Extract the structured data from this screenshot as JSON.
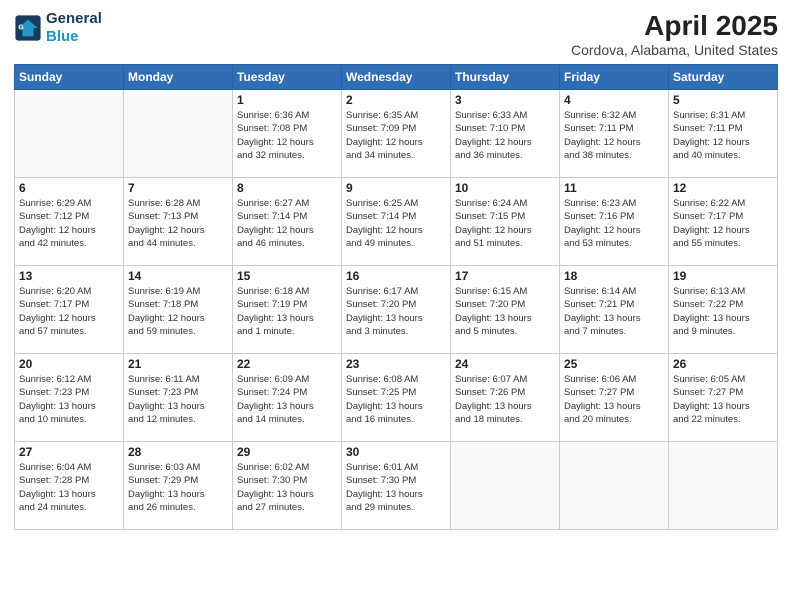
{
  "logo": {
    "line1": "General",
    "line2": "Blue"
  },
  "title": "April 2025",
  "subtitle": "Cordova, Alabama, United States",
  "days_of_week": [
    "Sunday",
    "Monday",
    "Tuesday",
    "Wednesday",
    "Thursday",
    "Friday",
    "Saturday"
  ],
  "weeks": [
    [
      {
        "num": "",
        "info": ""
      },
      {
        "num": "",
        "info": ""
      },
      {
        "num": "1",
        "info": "Sunrise: 6:36 AM\nSunset: 7:08 PM\nDaylight: 12 hours\nand 32 minutes."
      },
      {
        "num": "2",
        "info": "Sunrise: 6:35 AM\nSunset: 7:09 PM\nDaylight: 12 hours\nand 34 minutes."
      },
      {
        "num": "3",
        "info": "Sunrise: 6:33 AM\nSunset: 7:10 PM\nDaylight: 12 hours\nand 36 minutes."
      },
      {
        "num": "4",
        "info": "Sunrise: 6:32 AM\nSunset: 7:11 PM\nDaylight: 12 hours\nand 38 minutes."
      },
      {
        "num": "5",
        "info": "Sunrise: 6:31 AM\nSunset: 7:11 PM\nDaylight: 12 hours\nand 40 minutes."
      }
    ],
    [
      {
        "num": "6",
        "info": "Sunrise: 6:29 AM\nSunset: 7:12 PM\nDaylight: 12 hours\nand 42 minutes."
      },
      {
        "num": "7",
        "info": "Sunrise: 6:28 AM\nSunset: 7:13 PM\nDaylight: 12 hours\nand 44 minutes."
      },
      {
        "num": "8",
        "info": "Sunrise: 6:27 AM\nSunset: 7:14 PM\nDaylight: 12 hours\nand 46 minutes."
      },
      {
        "num": "9",
        "info": "Sunrise: 6:25 AM\nSunset: 7:14 PM\nDaylight: 12 hours\nand 49 minutes."
      },
      {
        "num": "10",
        "info": "Sunrise: 6:24 AM\nSunset: 7:15 PM\nDaylight: 12 hours\nand 51 minutes."
      },
      {
        "num": "11",
        "info": "Sunrise: 6:23 AM\nSunset: 7:16 PM\nDaylight: 12 hours\nand 53 minutes."
      },
      {
        "num": "12",
        "info": "Sunrise: 6:22 AM\nSunset: 7:17 PM\nDaylight: 12 hours\nand 55 minutes."
      }
    ],
    [
      {
        "num": "13",
        "info": "Sunrise: 6:20 AM\nSunset: 7:17 PM\nDaylight: 12 hours\nand 57 minutes."
      },
      {
        "num": "14",
        "info": "Sunrise: 6:19 AM\nSunset: 7:18 PM\nDaylight: 12 hours\nand 59 minutes."
      },
      {
        "num": "15",
        "info": "Sunrise: 6:18 AM\nSunset: 7:19 PM\nDaylight: 13 hours\nand 1 minute."
      },
      {
        "num": "16",
        "info": "Sunrise: 6:17 AM\nSunset: 7:20 PM\nDaylight: 13 hours\nand 3 minutes."
      },
      {
        "num": "17",
        "info": "Sunrise: 6:15 AM\nSunset: 7:20 PM\nDaylight: 13 hours\nand 5 minutes."
      },
      {
        "num": "18",
        "info": "Sunrise: 6:14 AM\nSunset: 7:21 PM\nDaylight: 13 hours\nand 7 minutes."
      },
      {
        "num": "19",
        "info": "Sunrise: 6:13 AM\nSunset: 7:22 PM\nDaylight: 13 hours\nand 9 minutes."
      }
    ],
    [
      {
        "num": "20",
        "info": "Sunrise: 6:12 AM\nSunset: 7:23 PM\nDaylight: 13 hours\nand 10 minutes."
      },
      {
        "num": "21",
        "info": "Sunrise: 6:11 AM\nSunset: 7:23 PM\nDaylight: 13 hours\nand 12 minutes."
      },
      {
        "num": "22",
        "info": "Sunrise: 6:09 AM\nSunset: 7:24 PM\nDaylight: 13 hours\nand 14 minutes."
      },
      {
        "num": "23",
        "info": "Sunrise: 6:08 AM\nSunset: 7:25 PM\nDaylight: 13 hours\nand 16 minutes."
      },
      {
        "num": "24",
        "info": "Sunrise: 6:07 AM\nSunset: 7:26 PM\nDaylight: 13 hours\nand 18 minutes."
      },
      {
        "num": "25",
        "info": "Sunrise: 6:06 AM\nSunset: 7:27 PM\nDaylight: 13 hours\nand 20 minutes."
      },
      {
        "num": "26",
        "info": "Sunrise: 6:05 AM\nSunset: 7:27 PM\nDaylight: 13 hours\nand 22 minutes."
      }
    ],
    [
      {
        "num": "27",
        "info": "Sunrise: 6:04 AM\nSunset: 7:28 PM\nDaylight: 13 hours\nand 24 minutes."
      },
      {
        "num": "28",
        "info": "Sunrise: 6:03 AM\nSunset: 7:29 PM\nDaylight: 13 hours\nand 26 minutes."
      },
      {
        "num": "29",
        "info": "Sunrise: 6:02 AM\nSunset: 7:30 PM\nDaylight: 13 hours\nand 27 minutes."
      },
      {
        "num": "30",
        "info": "Sunrise: 6:01 AM\nSunset: 7:30 PM\nDaylight: 13 hours\nand 29 minutes."
      },
      {
        "num": "",
        "info": ""
      },
      {
        "num": "",
        "info": ""
      },
      {
        "num": "",
        "info": ""
      }
    ]
  ]
}
